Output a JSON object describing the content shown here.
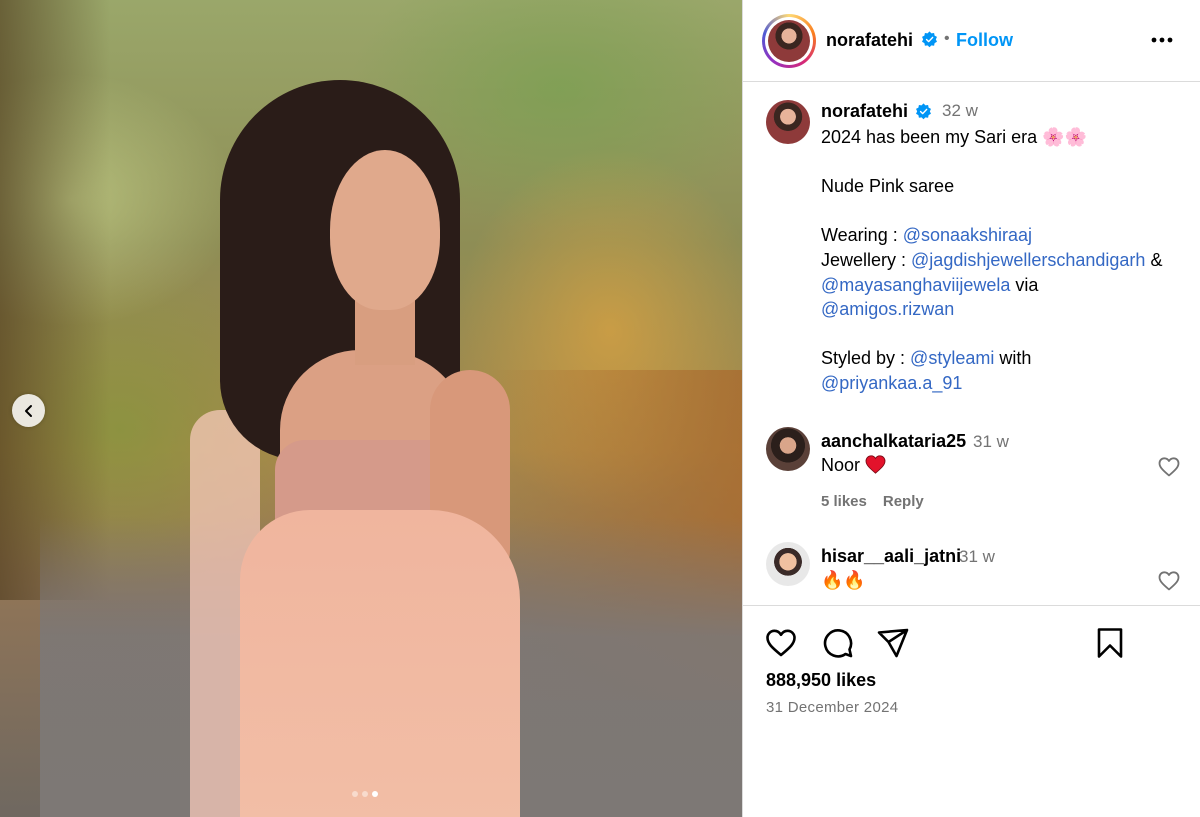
{
  "post": {
    "username": "norafatehi",
    "follow_label": "Follow",
    "header_separator": "•",
    "slide_count": 3,
    "active_slide": 3
  },
  "caption": {
    "username": "norafatehi",
    "time": "32 w",
    "line1": "2024 has been my Sari era 🌸🌸",
    "line2": "Nude Pink saree",
    "wearing_label": "Wearing : ",
    "wearing_mention": "@sonaakshiraaj",
    "jewellery_label": "Jewellery : ",
    "jewellery_mention1": "@jagdishjewellerschandigarh",
    "amp": " &",
    "jewellery_mention2": "@mayasanghaviijewela",
    "via": " via",
    "via_mention": "@amigos.rizwan",
    "styled_label": "Styled by : ",
    "styled_mention1": "@styleami",
    "with": " with",
    "styled_mention2": "@priyankaa.a_91"
  },
  "comments": [
    {
      "username": "aanchalkataria25",
      "time": "31 w",
      "text": "Noor",
      "likes": "5 likes",
      "reply": "Reply"
    },
    {
      "username": "hisar__aali_jatni",
      "time": "31 w",
      "text": "🔥🔥"
    }
  ],
  "actions": {
    "likes_count": "888,950 likes",
    "date": "31 December 2024"
  },
  "icons": [
    "verified-badge-icon",
    "more-options-icon",
    "heart-icon",
    "comment-icon",
    "share-icon",
    "bookmark-icon",
    "chevron-left-icon"
  ],
  "colors": {
    "link": "#0095f6",
    "mention": "#3468c4",
    "verified": "#0095f6",
    "muted": "#737373"
  }
}
